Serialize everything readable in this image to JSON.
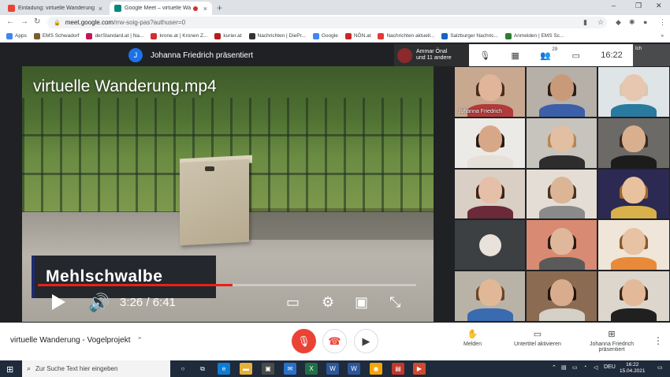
{
  "browser": {
    "tabs": [
      {
        "title": "Einladung: virtuelle Wanderung",
        "close": "×"
      },
      {
        "title": "Google Meet – virtuelle Wa",
        "close": "×"
      }
    ],
    "new_tab": "+",
    "window_controls": {
      "minimize": "–",
      "maximize": "❐",
      "close": "✕"
    },
    "url": {
      "host": "meet.google.com",
      "path": "/rrw-soig-pas?authuser=0"
    },
    "bookmarks": [
      {
        "label": "Apps",
        "color": "#4285f4"
      },
      {
        "label": "EMS Schwadorf",
        "color": "#7b5e2a"
      },
      {
        "label": "derStandard.at | Na...",
        "color": "#c2185b"
      },
      {
        "label": "krone.at | Kronen Z...",
        "color": "#d32f2f"
      },
      {
        "label": "kurier.at",
        "color": "#b71c1c"
      },
      {
        "label": "Nachrichten | DiePr...",
        "color": "#333333"
      },
      {
        "label": "Google",
        "color": "#4285f4"
      },
      {
        "label": "NÖN.at",
        "color": "#c62828"
      },
      {
        "label": "Nachrichten aktuell...",
        "color": "#e53935"
      },
      {
        "label": "Salzburger Nachric...",
        "color": "#1565c0"
      },
      {
        "label": "Anmelden | EMS Sc...",
        "color": "#2e7d32"
      }
    ],
    "bookmarks_more": "»"
  },
  "meet": {
    "presenter_initial": "J",
    "presenter_text": "Johanna Friedrich präsentiert",
    "join_notice": {
      "line1": "Ammar Önal",
      "line2": "und 11 andere"
    },
    "participant_count": "29",
    "clock": "16:22",
    "self_label": "Ich",
    "video": {
      "title": "virtuelle Wanderung.mp4",
      "caption": "Mehlschwalbe",
      "current_time": "3:26",
      "duration": "6:41",
      "time_display": "3:26 / 6:41",
      "progress": 0.514
    },
    "participants": [
      {
        "name": "Johanna Friedrich",
        "skin": "#e0b59a",
        "hair": "#4a2a1a",
        "shirt": "#b33a3a",
        "bg": "#c9a890"
      },
      {
        "name": "",
        "skin": "#c99a7a",
        "hair": "#2b1d14",
        "shirt": "#3b5fa8",
        "bg": "#b7b0a8"
      },
      {
        "name": "",
        "skin": "#e8c7b0",
        "hair": "#d9c9b0",
        "shirt": "#2a7aa0",
        "bg": "#dfe4e6"
      },
      {
        "name": "",
        "skin": "#d7a888",
        "hair": "#2a1a12",
        "shirt": "#e5e0d8",
        "bg": "#eceae6"
      },
      {
        "name": "",
        "skin": "#e2bea2",
        "hair": "#b8864f",
        "shirt": "#2d2d2d",
        "bg": "#c7c3bd"
      },
      {
        "name": "",
        "skin": "#d9b08f",
        "hair": "#3a2a1e",
        "shirt": "#1c1c1c",
        "bg": "#6c6a66"
      },
      {
        "name": "",
        "skin": "#e6bfa8",
        "hair": "#3e2417",
        "shirt": "#6a2a3a",
        "bg": "#d9cfc4"
      },
      {
        "name": "",
        "skin": "#dcb596",
        "hair": "#4a3322",
        "shirt": "#8a8a8a",
        "bg": "#e3ddd5"
      },
      {
        "name": "",
        "skin": "#e8c29f",
        "hair": "#a0662f",
        "shirt": "#d9b14a",
        "bg": "#2c2a52"
      },
      {
        "name": "",
        "avatar": true,
        "bg": "#3c4043"
      },
      {
        "name": "",
        "skin": "#dfb79a",
        "hair": "#2a1a14",
        "shirt": "#5a5a5a",
        "bg": "#d98a72"
      },
      {
        "name": "",
        "skin": "#e7c2a3",
        "hair": "#8a5a2a",
        "shirt": "#e88a3a",
        "bg": "#efe5d8"
      },
      {
        "name": "",
        "skin": "#e0b898",
        "hair": "#6a4428",
        "shirt": "#3a6ab0",
        "bg": "#b9b2a7"
      },
      {
        "name": "",
        "skin": "#d8ac8c",
        "hair": "#1e1410",
        "shirt": "#d4d0c8",
        "bg": "#8b6b52"
      },
      {
        "name": "",
        "skin": "#e3b999",
        "hair": "#3a2818",
        "shirt": "#202020",
        "bg": "#dcd6cc"
      }
    ]
  },
  "bottom": {
    "meeting_name": "virtuelle Wanderung - Vogelprojekt",
    "chevron": "⌃",
    "actions": [
      {
        "label": "Melden",
        "icon": "hand-icon"
      },
      {
        "label": "Untertitel aktivieren",
        "icon": "captions-icon"
      },
      {
        "label": "Johanna Friedrich präsentiert",
        "icon": "present-icon"
      }
    ],
    "more": "⋮"
  },
  "taskbar": {
    "search_placeholder": "Zur Suche Text hier eingeben",
    "language": "DEU",
    "time": "16:22",
    "date": "15.04.2021"
  }
}
